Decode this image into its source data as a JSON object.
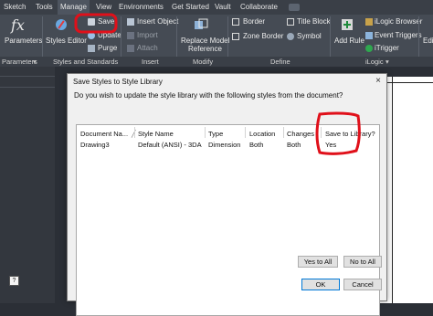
{
  "ribbon": {
    "tabs": [
      "Sketch",
      "Tools",
      "Manage",
      "View",
      "Environments",
      "Get Started",
      "Vault",
      "Collaborate"
    ],
    "active_tab": "Manage",
    "parameters_label": "Parameters",
    "styles_editor_label": "Styles Editor",
    "save_label": "Save",
    "update_label": "Update",
    "purge_label": "Purge",
    "insert_object_label": "Insert Object",
    "import_label": "Import",
    "attach_label": "Attach",
    "replace_model_label_1": "Replace Model",
    "replace_model_label_2": "Reference",
    "border_label": "Border",
    "title_block_label": "Title Block",
    "zone_border_label": "Zone Border",
    "symbol_label": "Symbol",
    "add_rule_label": "Add Rule",
    "ilogic_browser_label": "iLogic Browser",
    "event_triggers_label": "Event Triggers",
    "itrigger_label": "iTrigger",
    "edit_label": "Edi",
    "groups": {
      "parameters": "Parameters",
      "styles": "Styles and Standards",
      "insert": "Insert",
      "modify": "Modify",
      "define": "Define",
      "ilogic": "iLogic"
    }
  },
  "dialog": {
    "title": "Save Styles to Style Library",
    "prompt": "Do you wish to update the style library with the following styles from the document?",
    "columns": [
      "Document Na...",
      "Style Name",
      "Type",
      "Location",
      "Changes",
      "Save to Library?"
    ],
    "rows": [
      [
        "Drawing3",
        "Default (ANSI) - 3DA",
        "Dimension",
        "Both",
        "Both",
        "Yes"
      ]
    ],
    "yes_to_all": "Yes to All",
    "no_to_all": "No to All",
    "ok": "OK",
    "cancel": "Cancel",
    "help": "?"
  },
  "colors": {
    "annotation_red": "#e0101a",
    "ribbon_bg": "#454b54",
    "dialog_bg": "#f0f0f0"
  }
}
